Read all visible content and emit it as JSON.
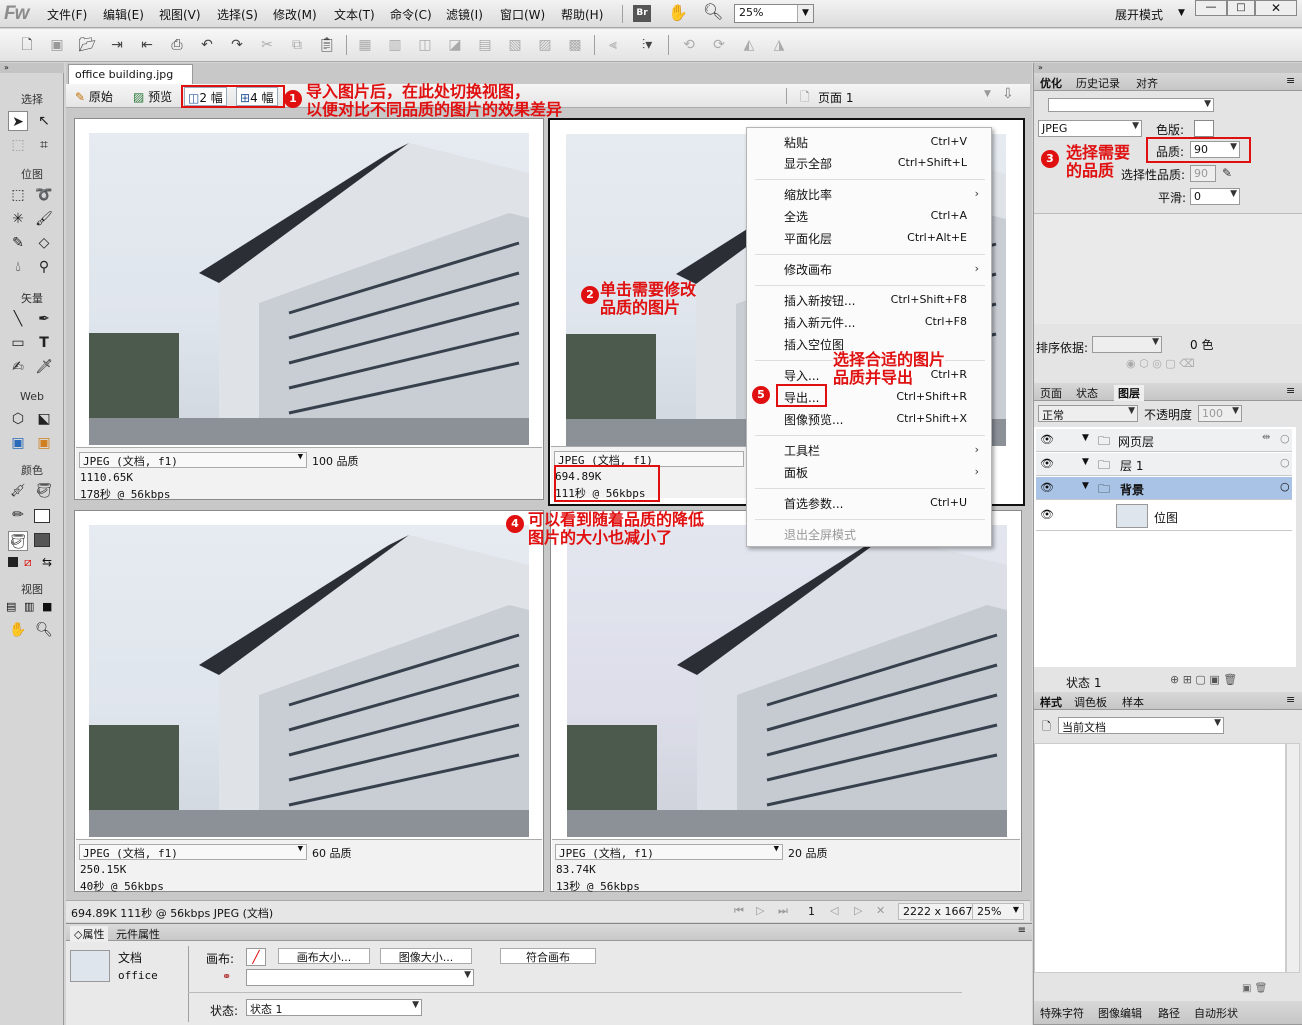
{
  "menubar": {
    "logo": "Fw",
    "items": [
      "文件(F)",
      "编辑(E)",
      "视图(V)",
      "选择(S)",
      "修改(M)",
      "文本(T)",
      "命令(C)",
      "滤镜(I)",
      "窗口(W)",
      "帮助(H)"
    ],
    "br": "Br",
    "zoom": "25%",
    "workspace": "展开模式"
  },
  "document": {
    "tab_name": "office building.jpg",
    "tab_close": "×",
    "view_original": "原始",
    "view_preview": "预览",
    "view_2up": "2 幅",
    "view_4up": "4 幅",
    "page": "页面 1"
  },
  "panes": [
    {
      "format": "JPEG (文档, f1)",
      "quality": "100 品质",
      "size": "1110.65K",
      "time": "178秒 @ 56kbps"
    },
    {
      "format": "JPEG (文档, f1)",
      "quality": "",
      "size": "694.89K",
      "time": "111秒 @ 56kbps"
    },
    {
      "format": "JPEG (文档, f1)",
      "quality": "60 品质",
      "size": "250.15K",
      "time": "40秒 @ 56kbps"
    },
    {
      "format": "JPEG (文档, f1)",
      "quality": "20 品质",
      "size": "83.74K",
      "time": "13秒 @ 56kbps"
    }
  ],
  "context_menu": [
    {
      "label": "粘贴",
      "shortcut": "Ctrl+V"
    },
    {
      "label": "显示全部",
      "shortcut": "Ctrl+Shift+L"
    },
    {
      "label": "缩放比率",
      "shortcut": "",
      "submenu": true
    },
    {
      "label": "全选",
      "shortcut": "Ctrl+A"
    },
    {
      "label": "平面化层",
      "shortcut": "Ctrl+Alt+E"
    },
    {
      "label": "修改画布",
      "shortcut": "",
      "submenu": true
    },
    {
      "label": "插入新按钮...",
      "shortcut": "Ctrl+Shift+F8"
    },
    {
      "label": "插入新元件...",
      "shortcut": "Ctrl+F8"
    },
    {
      "label": "插入空位图",
      "shortcut": ""
    },
    {
      "label": "导入...",
      "shortcut": "Ctrl+R"
    },
    {
      "label": "导出...",
      "shortcut": "Ctrl+Shift+R"
    },
    {
      "label": "图像预览...",
      "shortcut": "Ctrl+Shift+X"
    },
    {
      "label": "工具栏",
      "shortcut": "",
      "submenu": true
    },
    {
      "label": "面板",
      "shortcut": "",
      "submenu": true
    },
    {
      "label": "首选参数...",
      "shortcut": "Ctrl+U"
    },
    {
      "label": "退出全屏模式",
      "shortcut": "",
      "disabled": true
    }
  ],
  "annotations": {
    "a1_line1": "导入图片后，在此处切换视图，",
    "a1_line2": "以便对比不同品质的图片的效果差异",
    "a2_line1": "单击需要修改",
    "a2_line2": "品质的图片",
    "a3_line1": "选择需要",
    "a3_line2": "的品质",
    "a4_line1": "可以看到随着品质的降低",
    "a4_line2": "图片的大小也减小了",
    "a5_line1": "选择合适的图片",
    "a5_line2": "品质并导出",
    "n1": "1",
    "n2": "2",
    "n3": "3",
    "n4": "4",
    "n5": "5"
  },
  "tools": {
    "select": "选择",
    "bitmap": "位图",
    "vector": "矢量",
    "web": "Web",
    "color": "颜色",
    "view": "视图"
  },
  "statusbar": {
    "info": "694.89K  111秒 @ 56kbps  JPEG (文档)",
    "frame": "1",
    "dims": "2222 x 1667",
    "zoom": "25%"
  },
  "properties": {
    "tab1": "属性",
    "tab2": "元件属性",
    "doc_label": "文档",
    "doc_name": "office",
    "canvas_label": "画布:",
    "btn_canvas_size": "画布大小...",
    "btn_image_size": "图像大小...",
    "btn_fit_canvas": "符合画布",
    "state_label": "状态:",
    "state_value": "状态 1"
  },
  "optimize": {
    "tab1": "优化",
    "tab2": "历史记录",
    "tab3": "对齐",
    "format": "JPEG",
    "matte_label": "色版:",
    "quality_label": "品质:",
    "quality": "90",
    "selective_label": "选择性品质:",
    "selective": "90",
    "smooth_label": "平滑:",
    "smooth": "0",
    "sort_label": "排序依据:",
    "colors": "0 色"
  },
  "layers": {
    "tab1": "页面",
    "tab2": "状态",
    "tab3": "图层",
    "blend": "正常",
    "opacity_label": "不透明度",
    "opacity": "100",
    "rows": [
      "网页层",
      "层 1",
      "背景",
      "位图"
    ],
    "state": "状态 1"
  },
  "styles": {
    "tab1": "样式",
    "tab2": "调色板",
    "tab3": "样本",
    "select": "当前文档"
  },
  "bottom_tabs": [
    "特殊字符",
    "图像编辑",
    "路径",
    "自动形状"
  ]
}
